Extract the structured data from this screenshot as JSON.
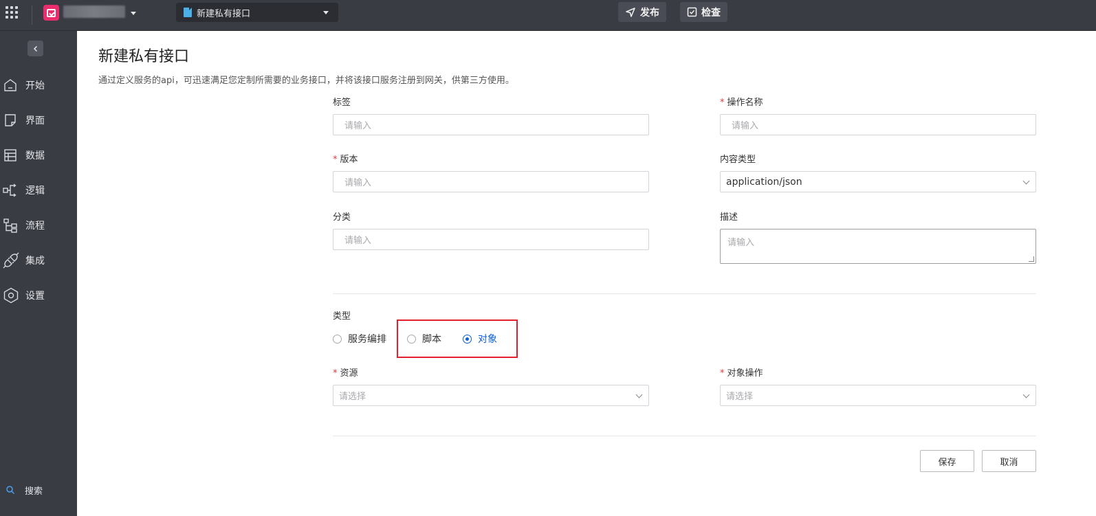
{
  "topbar": {
    "current_file": "新建私有接口",
    "publish_label": "发布",
    "check_label": "检查"
  },
  "sidebar": {
    "items": [
      {
        "label": "开始",
        "icon": "home-icon"
      },
      {
        "label": "界面",
        "icon": "page-icon"
      },
      {
        "label": "数据",
        "icon": "table-icon"
      },
      {
        "label": "逻辑",
        "icon": "logic-icon"
      },
      {
        "label": "流程",
        "icon": "flow-icon"
      },
      {
        "label": "集成",
        "icon": "plug-icon"
      },
      {
        "label": "设置",
        "icon": "hexagon-settings-icon"
      }
    ],
    "search_label": "搜索"
  },
  "page": {
    "title": "新建私有接口",
    "description": "通过定义服务的api，可迅速满足您定制所需要的业务接口，并将该接口服务注册到网关，供第三方使用。"
  },
  "form": {
    "tag": {
      "label": "标签",
      "placeholder": "请输入"
    },
    "operation_name": {
      "label": "操作名称",
      "placeholder": "请输入",
      "required": true
    },
    "version": {
      "label": "版本",
      "placeholder": "请输入",
      "required": true
    },
    "content_type": {
      "label": "内容类型",
      "value": "application/json"
    },
    "category": {
      "label": "分类",
      "placeholder": "请输入"
    },
    "description": {
      "label": "描述",
      "placeholder": "请输入"
    },
    "type": {
      "label": "类型",
      "options": [
        "服务编排",
        "脚本",
        "对象"
      ],
      "selected": "对象"
    },
    "resource": {
      "label": "资源",
      "placeholder": "请选择",
      "required": true
    },
    "object_operation": {
      "label": "对象操作",
      "placeholder": "请选择",
      "required": true
    },
    "req_mark": "*"
  },
  "actions": {
    "save_label": "保存",
    "cancel_label": "取消"
  },
  "colors": {
    "accent": "#0a5fd8",
    "highlight": "#e3202b",
    "sidebar_bg": "#3a3c44",
    "app_icon": "#ea2d6c"
  }
}
